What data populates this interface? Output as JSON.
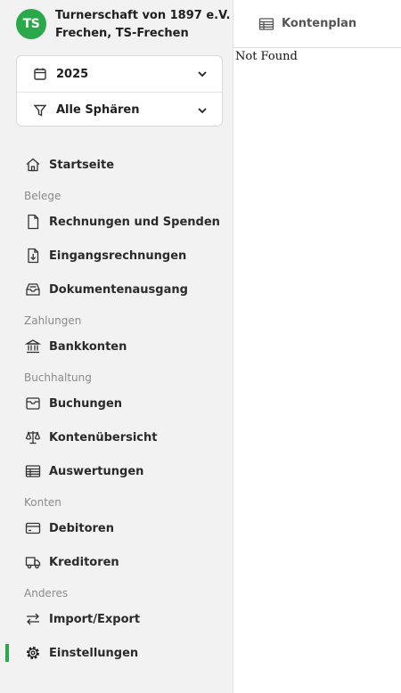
{
  "org": {
    "logo_text": "TS",
    "name_line1": "Turnerschaft von 1897 e.V.",
    "name_line2": "Frechen, TS-Frechen",
    "brand_color": "#2aa84a"
  },
  "selectors": {
    "year": "2025",
    "sphere": "Alle Sphären"
  },
  "nav": {
    "home": "Startseite",
    "sections": {
      "belege": "Belege",
      "zahlungen": "Zahlungen",
      "buchhaltung": "Buchhaltung",
      "konten": "Konten",
      "anderes": "Anderes"
    },
    "items": {
      "rechnungen": "Rechnungen und Spenden",
      "eingangsrechnungen": "Eingangsrechnungen",
      "dokumentenausgang": "Dokumentenausgang",
      "bankkonten": "Bankkonten",
      "buchungen": "Buchungen",
      "kontenuebersicht": "Kontenübersicht",
      "auswertungen": "Auswertungen",
      "debitoren": "Debitoren",
      "kreditoren": "Kreditoren",
      "import_export": "Import/Export",
      "einstellungen": "Einstellungen"
    },
    "active": "Einstellungen"
  },
  "main": {
    "tab_title": "Kontenplan",
    "body_text": "Not Found"
  }
}
